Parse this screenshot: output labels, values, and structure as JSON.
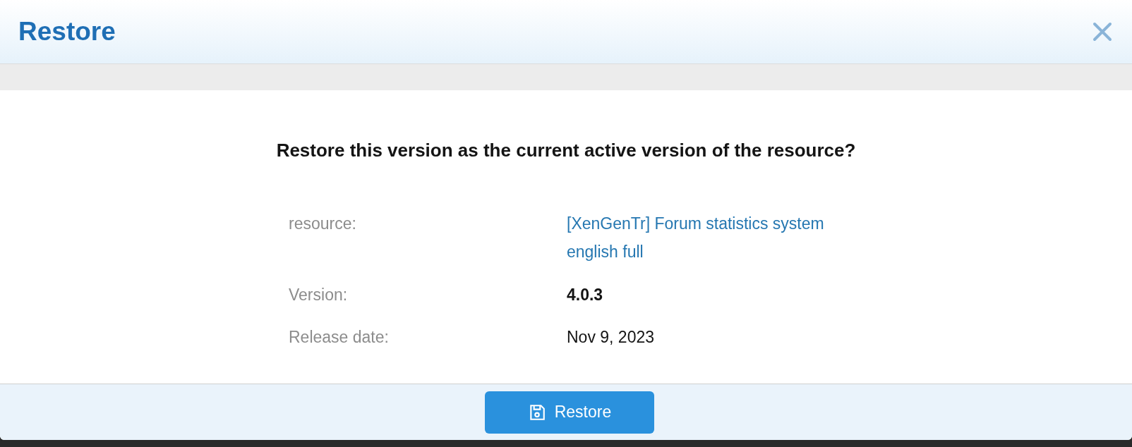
{
  "dialog": {
    "title": "Restore",
    "question": "Restore this version as the current active version of the resource?",
    "fields": [
      {
        "kind": "link",
        "label": "resource:",
        "value": "[XenGenTr] Forum statistics system english full"
      },
      {
        "kind": "bold",
        "label": "Version:",
        "value": "4.0.3"
      },
      {
        "kind": "plain",
        "label": "Release date:",
        "value": "Nov 9, 2023"
      }
    ],
    "button": "Restore"
  }
}
